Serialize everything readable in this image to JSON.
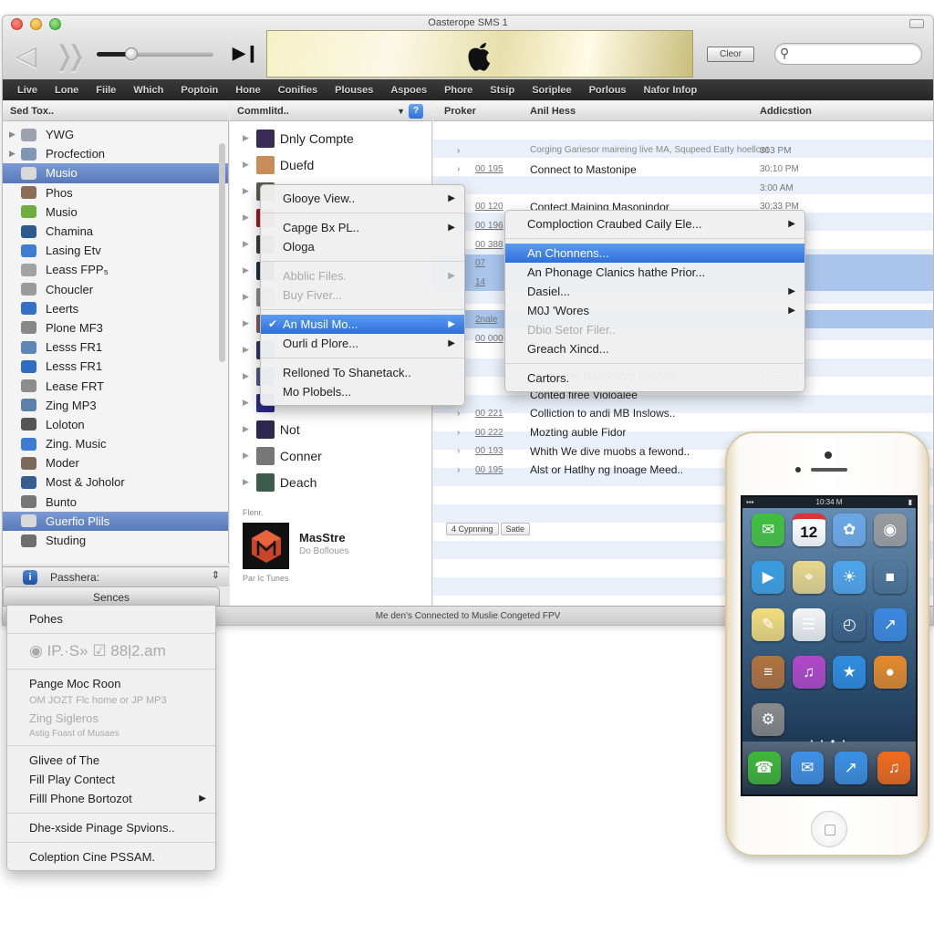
{
  "window": {
    "title": "Oasterope SMS 1",
    "clear_label": "Cleor",
    "search_placeholder": ""
  },
  "playback": {
    "volume_level": 0.3
  },
  "menubar": [
    "Live",
    "Lone",
    "Fiile",
    "Which",
    "Poptoin",
    "Hone",
    "Conifies",
    "Plouses",
    "Aspoes",
    "Phore",
    "Stsip",
    "Soriplee",
    "Porlous",
    "Nafor Infop"
  ],
  "sidebar": {
    "header": "Sed Tox..",
    "items": [
      {
        "label": "YWG",
        "expand": true,
        "color": "#9aa3ad"
      },
      {
        "label": "Procfection",
        "expand": true,
        "color": "#7f96b4"
      },
      {
        "label": "Musio",
        "selected": true,
        "color": "#d9d9d9"
      },
      {
        "label": "Phos",
        "color": "#8b6e55"
      },
      {
        "label": "Musio",
        "color": "#6fae3e"
      },
      {
        "label": "Chamina",
        "color": "#2b5a8c"
      },
      {
        "label": "Lasing Etv",
        "color": "#3d7ed1"
      },
      {
        "label": "Leass FPP₅",
        "color": "#a3a3a3"
      },
      {
        "label": "Choucler",
        "color": "#9b9b9b"
      },
      {
        "label": "Leerts",
        "color": "#3670c6"
      },
      {
        "label": "Plone MF3",
        "color": "#888"
      },
      {
        "label": "Lesss FR1",
        "color": "#5f86b8"
      },
      {
        "label": "Lesss FR1",
        "color": "#2f6cc2"
      },
      {
        "label": "Lease FRT",
        "color": "#8d8d8d"
      },
      {
        "label": "Zing MP3",
        "color": "#5d7fa8"
      },
      {
        "label": "Loloton",
        "color": "#555"
      },
      {
        "label": "Zing. Music",
        "color": "#3f7bd0"
      },
      {
        "label": "Moder",
        "color": "#7a6a5a"
      },
      {
        "label": "Most & Joholor",
        "color": "#375d91"
      },
      {
        "label": "Bunto",
        "color": "#777"
      },
      {
        "label": "Guerfio Plils",
        "selected": true,
        "color": "#d9d9d9"
      },
      {
        "label": "Studing",
        "color": "#6d6d6d"
      }
    ],
    "footer_label": "Passhera:",
    "footer_tab": "Sences"
  },
  "center": {
    "header": "Commlitd..",
    "albums": [
      {
        "label": "Dnly Compte",
        "color": "#3b2a55"
      },
      {
        "label": "Duefd",
        "color": "#c98d5a"
      },
      {
        "label": "",
        "color": "#5b5b4a"
      },
      {
        "label": "",
        "color": "#9b1c22"
      },
      {
        "label": "",
        "color": "#3c3c3c"
      },
      {
        "label": "",
        "color": "#1d2d45"
      },
      {
        "label": "",
        "color": "#888"
      },
      {
        "label": "",
        "color": "#7a5a5a"
      },
      {
        "label": "",
        "color": "#2a3a5a"
      },
      {
        "label": "",
        "color": "#4a5a7a"
      },
      {
        "label": "",
        "color": "#2b2a8a"
      },
      {
        "label": "Not",
        "color": "#2e2850"
      },
      {
        "label": "Conner",
        "color": "#777"
      },
      {
        "label": "Deach",
        "color": "#3b5c4a"
      }
    ],
    "featured_label": "Flenr.",
    "featured_title": "MasStre",
    "featured_sub": "Do Bofloues",
    "featured_footer": "Par Ic Tunes"
  },
  "list": {
    "columns": [
      "Proker",
      "Anil Hess",
      "Addicstion"
    ],
    "rows": [
      {
        "num": "",
        "name": "Corging Gariesor maireing live MA, Squpeed Eatty hoelloot",
        "time": "303 PM",
        "sub": true
      },
      {
        "num": "00 195",
        "name": "Connect to Mastonipe",
        "time": "30:10 PM"
      },
      {
        "num": "",
        "name": "",
        "time": "3:00 AM"
      },
      {
        "num": "00 120",
        "name": "Contect Maining Masonindor",
        "time": "30:33 PM"
      },
      {
        "num": "00 196",
        "name": "",
        "time": ""
      },
      {
        "num": "00 388",
        "name": "",
        "time": ""
      },
      {
        "num": "07",
        "name": "",
        "time": "",
        "selected": true
      },
      {
        "num": "14",
        "name": "",
        "time": "",
        "selected": true
      },
      {
        "num": "",
        "name": "",
        "time": ""
      },
      {
        "num": "2nale",
        "name": "",
        "time": "",
        "selected": true
      },
      {
        "num": "00 000",
        "name": "",
        "time": ""
      },
      {
        "num": "",
        "name": "",
        "time": ""
      },
      {
        "num": "",
        "name": "Inomipoity Masoowny Phones",
        "time": "30:33 PM"
      },
      {
        "num": "",
        "name": "Conted firee Violoalee",
        "time": ""
      },
      {
        "num": "00 221",
        "name": "Colliction to andi MB Inslows..",
        "time": ""
      },
      {
        "num": "00 222",
        "name": "Mozting auble Fidor",
        "time": ""
      },
      {
        "num": "00 193",
        "name": "Whith We dive muobs a fewond..",
        "time": ""
      },
      {
        "num": "00 195",
        "name": "Alst or Hatlhy ng Inoage Meed..",
        "time": ""
      }
    ],
    "pill_1": "4 Cypnning",
    "pill_2": "Satle"
  },
  "status": "Me den's Connected to Muslie Congeted FPV",
  "context_menu": {
    "items": [
      {
        "label": "Glooye View..",
        "arrow": true
      },
      {
        "sep": true
      },
      {
        "label": "Capge Bx PL..",
        "arrow": true
      },
      {
        "label": "Ologa"
      },
      {
        "sep": true
      },
      {
        "label": "Abblic Files.",
        "arrow": true,
        "disabled": true
      },
      {
        "label": "Buy Fiver...",
        "disabled": true
      },
      {
        "sep": true
      },
      {
        "label": "An Musil Mo...",
        "arrow": true,
        "checked": true,
        "highlighted": true
      },
      {
        "label": "Ourli d Plore...",
        "arrow": true
      },
      {
        "sep": true
      },
      {
        "label": "Relloned To Shanetack.."
      },
      {
        "label": "Mo Plobels..."
      }
    ]
  },
  "submenu": {
    "items": [
      {
        "label": "Comploction Craubed Caily Ele...",
        "arrow": true
      },
      {
        "sep": true
      },
      {
        "label": "An Chonnens...",
        "highlighted": true
      },
      {
        "label": "An Phonage Clanics hathe Prior..."
      },
      {
        "label": "Dasiel...",
        "arrow": true
      },
      {
        "label": "M0J 'Wores",
        "arrow": true
      },
      {
        "label": "Dbio Setor Filer..",
        "disabled": true
      },
      {
        "label": "Greach Xincd..."
      },
      {
        "sep": true
      },
      {
        "label": "Cartors."
      }
    ]
  },
  "popup_menu": {
    "items": [
      {
        "label": "Pohes"
      },
      {
        "sep": true
      },
      {
        "label": "◉ IP.·S» ☑ 88ļ2.am",
        "disabled": true,
        "large": true
      },
      {
        "sep": true
      },
      {
        "label": "Pange Moc Roon"
      },
      {
        "label": "OM JOZT Flc home or JP MP3",
        "disabled": true,
        "small": true
      },
      {
        "label": "Zing Sigleros",
        "disabled": true
      },
      {
        "label": "Astig Foast of Musaes",
        "disabled": true,
        "tiny": true
      },
      {
        "sep": true
      },
      {
        "label": "Glivee of The"
      },
      {
        "label": "Fill Play Contect"
      },
      {
        "label": "Filll Phone Bortozot",
        "arrow": true
      },
      {
        "sep": true
      },
      {
        "label": "Dhe-xside Pinage Spvions.."
      },
      {
        "sep": true
      },
      {
        "label": "Coleption Cine PSSAM."
      }
    ]
  },
  "phone": {
    "status_time": "10:34 M",
    "calendar_day": "12",
    "apps": [
      {
        "name": "messages",
        "color": "#3fbf3a",
        "glyph": "✉"
      },
      {
        "name": "calendar",
        "color": "#ffffff",
        "glyph": "12"
      },
      {
        "name": "photos",
        "color": "#6aa7e6",
        "glyph": "✿"
      },
      {
        "name": "camera",
        "color": "#9a9a9a",
        "glyph": "◉"
      },
      {
        "name": "videos",
        "color": "#3a9de0",
        "glyph": "▶"
      },
      {
        "name": "maps",
        "color": "#e8d58a",
        "glyph": "⌖"
      },
      {
        "name": "weather",
        "color": "#4ea4ea",
        "glyph": "☀"
      },
      {
        "name": "passbook",
        "color": "#222",
        "glyph": "■"
      },
      {
        "name": "notes",
        "color": "#f3dc7b",
        "glyph": "✎"
      },
      {
        "name": "reminders",
        "color": "#f4f4f4",
        "glyph": "☰"
      },
      {
        "name": "clock",
        "color": "#111",
        "glyph": "◴"
      },
      {
        "name": "stocks",
        "color": "#3b88e0",
        "glyph": "↗"
      },
      {
        "name": "newsstand",
        "color": "#b2723c",
        "glyph": "≡"
      },
      {
        "name": "itunes",
        "color": "#b247c9",
        "glyph": "♫"
      },
      {
        "name": "app-store",
        "color": "#2e8ce0",
        "glyph": "★"
      },
      {
        "name": "game-center",
        "color": "#e58a2a",
        "glyph": "●"
      },
      {
        "name": "settings",
        "color": "#8a8a8a",
        "glyph": "⚙"
      }
    ],
    "dock": [
      {
        "name": "phone",
        "color": "#3eb637",
        "glyph": "☎"
      },
      {
        "name": "mail",
        "color": "#3f8fe6",
        "glyph": "✉"
      },
      {
        "name": "safari",
        "color": "#3a8fe3",
        "glyph": "↗"
      },
      {
        "name": "music",
        "color": "#f06a1c",
        "glyph": "♫"
      }
    ],
    "page_dots": "• • ● •"
  }
}
